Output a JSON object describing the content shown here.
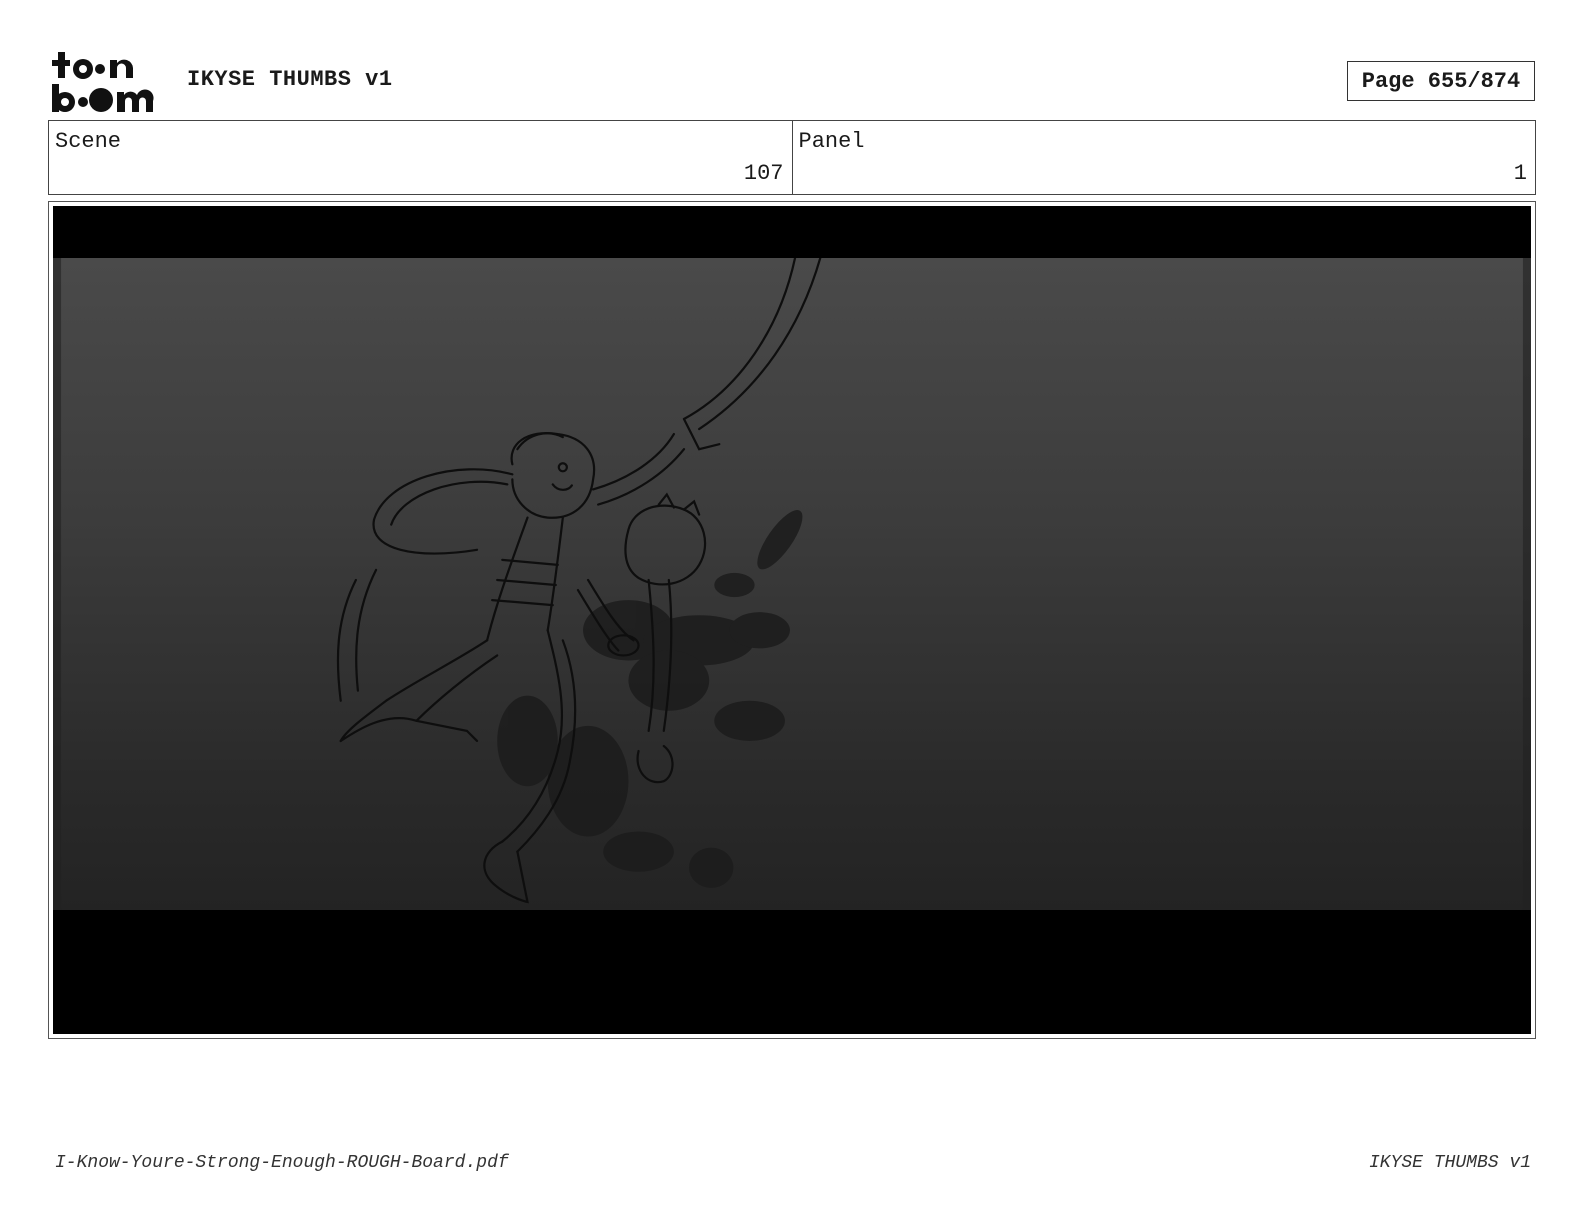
{
  "header": {
    "logo_text": "toonboom",
    "project_title": "IKYSE THUMBS v1",
    "page_indicator": "Page 655/874"
  },
  "info": {
    "scene_label": "Scene",
    "scene_number": "107",
    "panel_label": "Panel",
    "panel_number": "1"
  },
  "frame": {
    "description_icons": [
      "storyboard-sketch"
    ]
  },
  "footer": {
    "filename": "I-Know-Youre-Strong-Enough-ROUGH-Board.pdf",
    "project": "IKYSE THUMBS v1"
  }
}
